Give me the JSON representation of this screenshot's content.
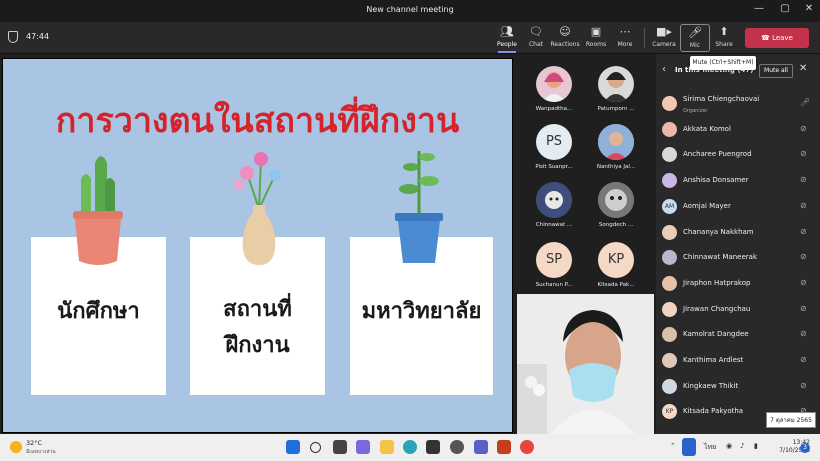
{
  "window": {
    "title": "New channel meeting",
    "minimize": "—",
    "maximize": "▢",
    "close": "✕"
  },
  "toolbar": {
    "timer": "47:44",
    "buttons": [
      {
        "label": "People",
        "icon": "people-icon"
      },
      {
        "label": "Chat",
        "icon": "chat-icon"
      },
      {
        "label": "Reactions",
        "icon": "reactions-icon"
      },
      {
        "label": "Rooms",
        "icon": "rooms-icon"
      },
      {
        "label": "More",
        "icon": "more-icon"
      },
      {
        "label": "Camera",
        "icon": "camera-icon"
      },
      {
        "label": "Mic",
        "icon": "mic-icon"
      },
      {
        "label": "Share",
        "icon": "share-icon"
      }
    ],
    "leave_label": "Leave",
    "mic_tooltip": "Mute (Ctrl+Shift+M)"
  },
  "slide": {
    "title": "การวางตนในสถานที่ฝึกงาน",
    "cards": [
      {
        "lines": [
          "นักศึกษา"
        ]
      },
      {
        "lines": [
          "สถานที่",
          "ฝึกงาน"
        ]
      },
      {
        "lines": [
          "มหาวิทยาลัย"
        ]
      }
    ]
  },
  "participants": [
    {
      "name": "Wanpadtha...",
      "initials": ""
    },
    {
      "name": "Patumporn ...",
      "initials": ""
    },
    {
      "name": "Pisit Suanpr...",
      "initials": "PS"
    },
    {
      "name": "Nanthiya Jal...",
      "initials": ""
    },
    {
      "name": "Chinnawat ...",
      "initials": ""
    },
    {
      "name": "Songdech ...",
      "initials": ""
    },
    {
      "name": "Suchanun P...",
      "initials": "SP"
    },
    {
      "name": "Kitsada Pak...",
      "initials": "KP"
    }
  ],
  "panel": {
    "title": "In this meeting (47)",
    "mute_all": "Mute all",
    "people": [
      {
        "name": "Sirima Chiengchaovai",
        "role": "Organizer",
        "initials": ""
      },
      {
        "name": "Akkata Komol",
        "role": "",
        "initials": ""
      },
      {
        "name": "Ancharee Puengrod",
        "role": "",
        "initials": ""
      },
      {
        "name": "Anshisa Donsamer",
        "role": "",
        "initials": ""
      },
      {
        "name": "Aomjai Mayer",
        "role": "",
        "initials": "AM"
      },
      {
        "name": "Chananya Nakkham",
        "role": "",
        "initials": ""
      },
      {
        "name": "Chinnawat Maneerak",
        "role": "",
        "initials": ""
      },
      {
        "name": "Jiraphon Hatprakop",
        "role": "",
        "initials": ""
      },
      {
        "name": "Jirawan Changchau",
        "role": "",
        "initials": ""
      },
      {
        "name": "Kamolrat Dangdee",
        "role": "",
        "initials": ""
      },
      {
        "name": "Kanthima Ardlest",
        "role": "",
        "initials": ""
      },
      {
        "name": "Kingkaew Thikit",
        "role": "",
        "initials": ""
      },
      {
        "name": "Kitsada Pakyotha",
        "role": "",
        "initials": "KP"
      }
    ],
    "date_tooltip": "7 ตุลาคม 2565"
  },
  "taskbar": {
    "temperature": "32°C",
    "weather_text": "มีเมฆบางส่วน",
    "language": "ไทย",
    "time": "13:42",
    "date": "7/10/2565",
    "notification_count": "3"
  },
  "colors": {
    "accent": "#8b8cf0",
    "leave": "#c4314b",
    "slide_bg": "#a9c5e3",
    "slide_title": "#d6232a"
  }
}
